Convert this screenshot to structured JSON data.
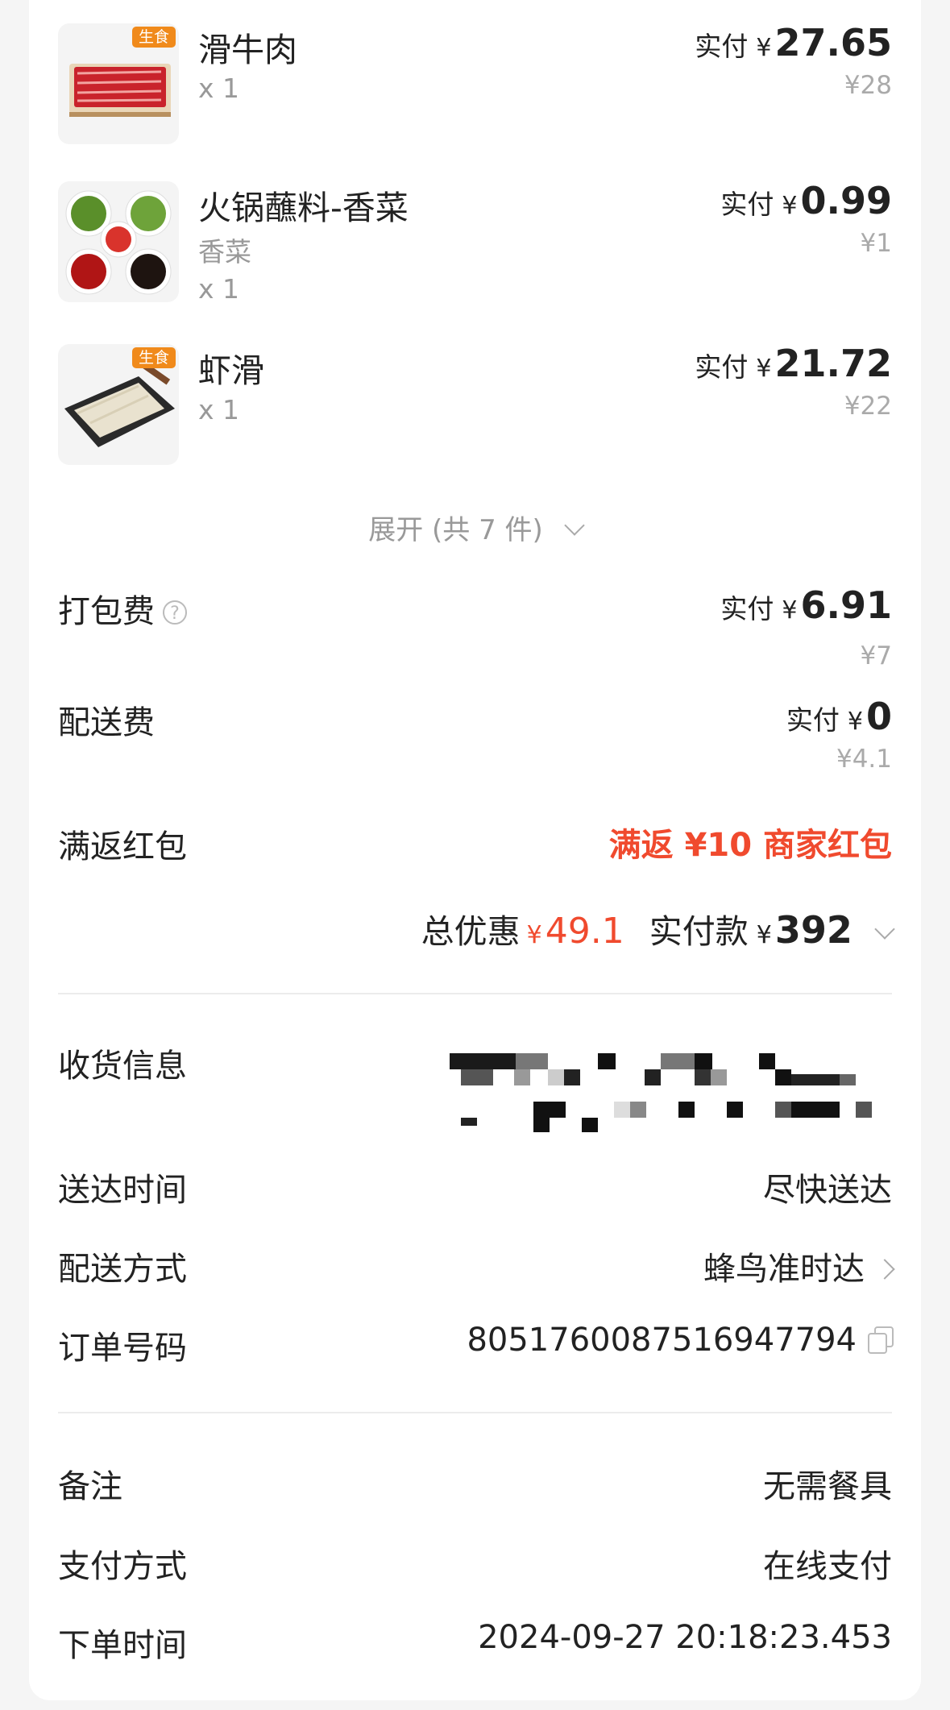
{
  "items": [
    {
      "name": "滑牛肉",
      "spec": "",
      "qty": "x 1",
      "tag": "生食",
      "pay_label": "实付",
      "yen": "¥",
      "pay_amount": "27.65",
      "original": "¥28"
    },
    {
      "name": "火锅蘸料-香菜",
      "spec": "香菜",
      "qty": "x 1",
      "tag": "",
      "pay_label": "实付",
      "yen": "¥",
      "pay_amount": "0.99",
      "original": "¥1"
    },
    {
      "name": "虾滑",
      "spec": "",
      "qty": "x 1",
      "tag": "生食",
      "pay_label": "实付",
      "yen": "¥",
      "pay_amount": "21.72",
      "original": "¥22"
    }
  ],
  "expand_label": "展开 (共 7 件)",
  "fees": {
    "packing": {
      "label": "打包费",
      "help": "?",
      "pay_label": "实付",
      "yen": "¥",
      "amount": "6.91",
      "original": "¥7"
    },
    "delivery": {
      "label": "配送费",
      "pay_label": "实付",
      "yen": "¥",
      "amount": "0",
      "original": "¥4.1"
    }
  },
  "promo": {
    "label": "满返红包",
    "value": "满返 ¥10 商家红包"
  },
  "summary": {
    "discount_label": "总优惠",
    "discount_yen": "¥",
    "discount_amount": "49.1",
    "paid_label": "实付款",
    "paid_yen": "¥",
    "paid_amount": "392"
  },
  "info": {
    "address_label": "收货信息",
    "delivery_time_label": "送达时间",
    "delivery_time_value": "尽快送达",
    "delivery_method_label": "配送方式",
    "delivery_method_value": "蜂鸟准时达",
    "order_no_label": "订单号码",
    "order_no_value": "8051760087516947794"
  },
  "extra": {
    "remark_label": "备注",
    "remark_value": "无需餐具",
    "payment_label": "支付方式",
    "payment_value": "在线支付",
    "order_time_label": "下单时间",
    "order_time_value": "2024-09-27 20:18:23.453"
  },
  "colors": {
    "accent_red": "#f04a2e",
    "tag_orange": "#f08a1b"
  },
  "icons": [
    "help-icon",
    "chevron-down-icon",
    "chevron-right-icon",
    "copy-icon"
  ]
}
